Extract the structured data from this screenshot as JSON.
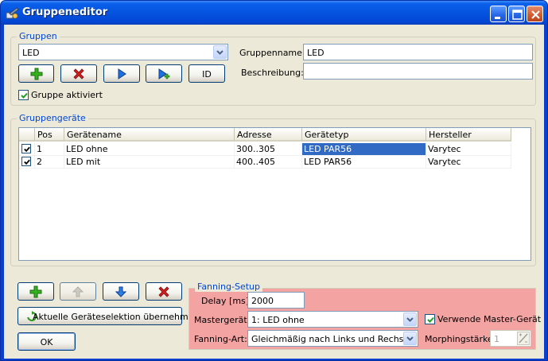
{
  "window": {
    "title": "Gruppeneditor",
    "colors": {
      "titlebar": "#0553e0",
      "client": "#ece9d8",
      "fanning_bg": "#f4a3a3",
      "selection": "#316ac5",
      "legend": "#0046d5"
    }
  },
  "gruppen": {
    "legend": "Gruppen",
    "group_select": {
      "value": "LED"
    },
    "buttons": {
      "id_label": "ID"
    },
    "name_label": "Gruppenname:",
    "name_value": "LED",
    "desc_label": "Beschreibung:",
    "desc_value": "",
    "active_label": "Gruppe aktiviert",
    "active_checked": true
  },
  "devices": {
    "legend": "Gruppengeräte",
    "columns": [
      "Pos",
      "Gerätename",
      "Adresse",
      "Gerätetyp",
      "Hersteller"
    ],
    "rows": [
      {
        "checked": true,
        "pos": "1",
        "name": "LED ohne",
        "address": "300..305",
        "type": "LED PAR56",
        "manufacturer": "Varytec"
      },
      {
        "checked": true,
        "pos": "2",
        "name": "LED mit",
        "address": "400..405",
        "type": "LED PAR56",
        "manufacturer": "Varytec"
      }
    ]
  },
  "actions": {
    "apply_selection_label": "Aktuelle Geräteselektion übernehmen",
    "ok_label": "OK"
  },
  "fanning": {
    "legend": "Fanning-Setup",
    "delay_label": "Delay [ms]:",
    "delay_value": "2000",
    "master_label": "Mastergerät:",
    "master_value": "1: LED ohne",
    "use_master_label": "Verwende Master-Gerät",
    "use_master_checked": true,
    "mode_label": "Fanning-Art:",
    "mode_value": "Gleichmäßig nach Links und Rechs",
    "morph_label": "Morphingstärke:",
    "morph_value": "1"
  }
}
